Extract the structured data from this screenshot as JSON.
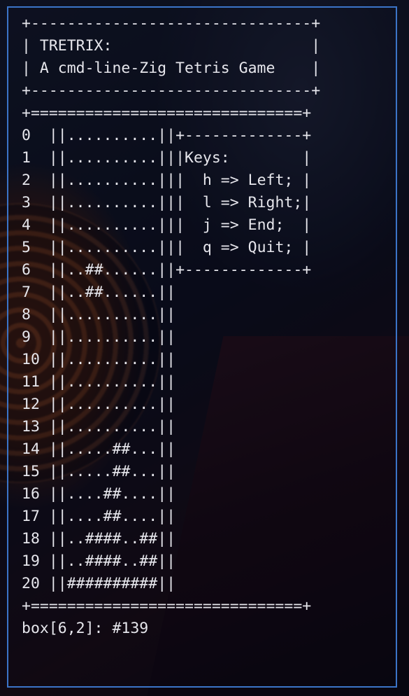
{
  "title_box": {
    "border": "+-------------------------------+",
    "line1": "| TRETRIX:                      |",
    "line2": "| A cmd-line-Zig Tetris Game    |"
  },
  "board_border": "+==============================+",
  "board_rows": [
    {
      "num": "0 ",
      "sep": " ||",
      "cells": "..........",
      "end": "||",
      "panel": "+-------------+"
    },
    {
      "num": "1 ",
      "sep": " ||",
      "cells": "..........",
      "end": "||",
      "panel": "|Keys:        |"
    },
    {
      "num": "2 ",
      "sep": " ||",
      "cells": "..........",
      "end": "||",
      "panel": "|  h => Left; |"
    },
    {
      "num": "3 ",
      "sep": " ||",
      "cells": "..........",
      "end": "||",
      "panel": "|  l => Right;|"
    },
    {
      "num": "4 ",
      "sep": " ||",
      "cells": "..........",
      "end": "||",
      "panel": "|  j => End;  |"
    },
    {
      "num": "5 ",
      "sep": " ||",
      "cells": "..........",
      "end": "||",
      "panel": "|  q => Quit; |"
    },
    {
      "num": "6 ",
      "sep": " ||",
      "cells": "..##......",
      "end": "||",
      "panel": "+-------------+"
    },
    {
      "num": "7 ",
      "sep": " ||",
      "cells": "..##......",
      "end": "||",
      "panel": ""
    },
    {
      "num": "8 ",
      "sep": " ||",
      "cells": "..........",
      "end": "||",
      "panel": ""
    },
    {
      "num": "9 ",
      "sep": " ||",
      "cells": "..........",
      "end": "||",
      "panel": ""
    },
    {
      "num": "10",
      "sep": " ||",
      "cells": "..........",
      "end": "||",
      "panel": ""
    },
    {
      "num": "11",
      "sep": " ||",
      "cells": "..........",
      "end": "||",
      "panel": ""
    },
    {
      "num": "12",
      "sep": " ||",
      "cells": "..........",
      "end": "||",
      "panel": ""
    },
    {
      "num": "13",
      "sep": " ||",
      "cells": "..........",
      "end": "||",
      "panel": ""
    },
    {
      "num": "14",
      "sep": " ||",
      "cells": ".....##...",
      "end": "||",
      "panel": ""
    },
    {
      "num": "15",
      "sep": " ||",
      "cells": ".....##...",
      "end": "||",
      "panel": ""
    },
    {
      "num": "16",
      "sep": " ||",
      "cells": "....##....",
      "end": "||",
      "panel": ""
    },
    {
      "num": "17",
      "sep": " ||",
      "cells": "....##....",
      "end": "||",
      "panel": ""
    },
    {
      "num": "18",
      "sep": " ||",
      "cells": "..####..##",
      "end": "||",
      "panel": ""
    },
    {
      "num": "19",
      "sep": " ||",
      "cells": "..####..##",
      "end": "||",
      "panel": ""
    },
    {
      "num": "20",
      "sep": " ||",
      "cells": "##########",
      "end": "||",
      "panel": ""
    }
  ],
  "status_line": "box[6,2]: #139",
  "colors": {
    "text": "#e6e6ec",
    "window_border": "#3b74c8"
  }
}
